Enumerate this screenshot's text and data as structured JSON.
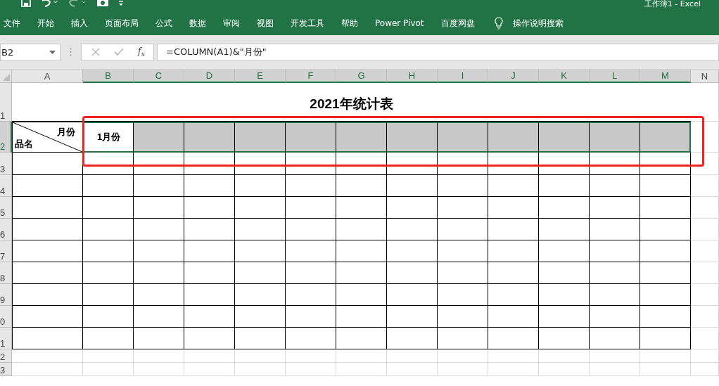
{
  "window": {
    "title": "工作簿1  -  Excel"
  },
  "quick_access": [
    {
      "kind": "save",
      "disabled": false
    },
    {
      "kind": "undo",
      "disabled": false
    },
    {
      "kind": "redo",
      "disabled": true
    },
    {
      "kind": "camera",
      "disabled": false
    },
    {
      "kind": "customize",
      "disabled": false
    }
  ],
  "ribbon_tabs": [
    {
      "label": "文件"
    },
    {
      "label": "开始"
    },
    {
      "label": "插入"
    },
    {
      "label": "页面布局"
    },
    {
      "label": "公式"
    },
    {
      "label": "数据"
    },
    {
      "label": "审阅"
    },
    {
      "label": "视图"
    },
    {
      "label": "开发工具"
    },
    {
      "label": "帮助"
    },
    {
      "label": "Power Pivot"
    },
    {
      "label": "百度网盘"
    }
  ],
  "tell_me": {
    "label": "操作说明搜索"
  },
  "formula_bar": {
    "name_box": "B2",
    "function_label": "f$_{x}$",
    "formula": "=COLUMN(A1)&\"月份\""
  },
  "columns": [
    {
      "label": "A",
      "selected": false
    },
    {
      "label": "B",
      "selected": true
    },
    {
      "label": "C",
      "selected": true
    },
    {
      "label": "D",
      "selected": true
    },
    {
      "label": "E",
      "selected": true
    },
    {
      "label": "F",
      "selected": true
    },
    {
      "label": "G",
      "selected": true
    },
    {
      "label": "H",
      "selected": true
    },
    {
      "label": "I",
      "selected": true
    },
    {
      "label": "J",
      "selected": true
    },
    {
      "label": "K",
      "selected": true
    },
    {
      "label": "L",
      "selected": true
    },
    {
      "label": "M",
      "selected": true
    },
    {
      "label": "N",
      "selected": false
    }
  ],
  "rows": [
    {
      "label": "1",
      "selected": false
    },
    {
      "label": "2",
      "selected": true
    },
    {
      "label": "3",
      "selected": false
    },
    {
      "label": "4",
      "selected": false
    },
    {
      "label": "5",
      "selected": false
    },
    {
      "label": "6",
      "selected": false
    },
    {
      "label": "7",
      "selected": false
    },
    {
      "label": "8",
      "selected": false
    },
    {
      "label": "9",
      "selected": false
    },
    {
      "label": "0",
      "selected": false
    },
    {
      "label": "1",
      "selected": false
    },
    {
      "label": "2",
      "selected": false
    },
    {
      "label": "3",
      "selected": false
    }
  ],
  "table": {
    "title": "2021年统计表",
    "corner_top": "月份",
    "corner_bottom": "品名",
    "header_cells": [
      {
        "text": "1月份",
        "selected": true,
        "active": true
      },
      {
        "selected": true,
        "active": false
      },
      {
        "selected": true,
        "active": false
      },
      {
        "selected": true,
        "active": false
      },
      {
        "selected": true,
        "active": false
      },
      {
        "selected": true,
        "active": false
      },
      {
        "selected": true,
        "active": false
      },
      {
        "selected": true,
        "active": false
      },
      {
        "selected": true,
        "active": false
      },
      {
        "selected": true,
        "active": false
      },
      {
        "selected": true,
        "active": false
      },
      {
        "selected": true,
        "active": false
      }
    ]
  },
  "highlight": {
    "visible": true
  }
}
